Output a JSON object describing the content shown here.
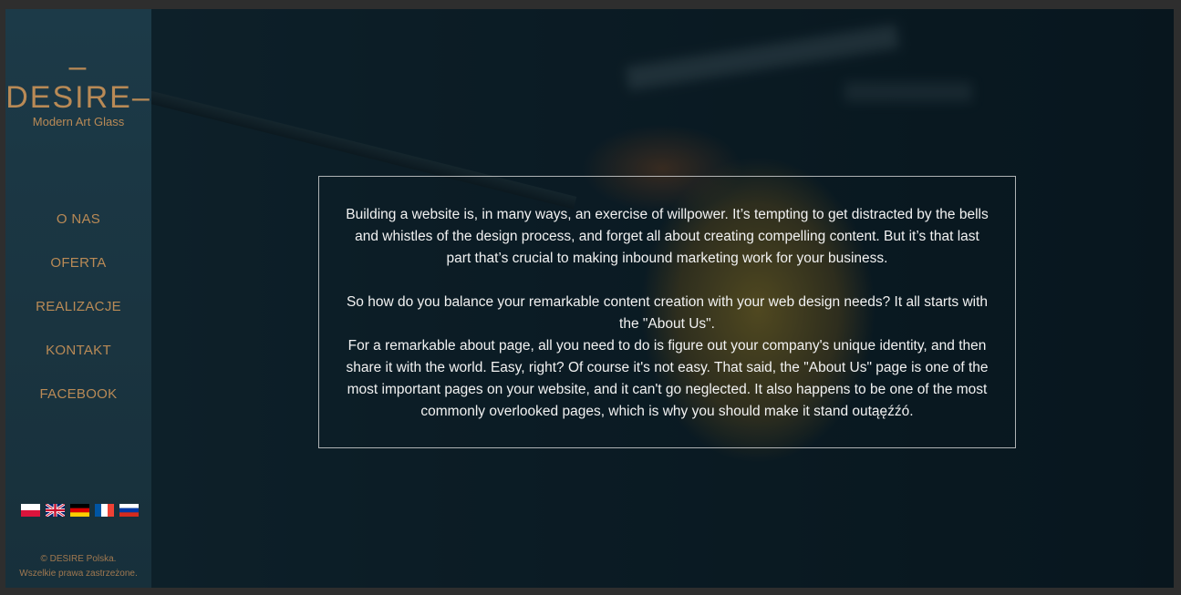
{
  "brand": {
    "title": "–DESIRE–",
    "subtitle": "Modern Art Glass"
  },
  "nav": {
    "items": [
      {
        "label": "O NAS"
      },
      {
        "label": "OFERTA"
      },
      {
        "label": "REALIZACJE"
      },
      {
        "label": "KONTAKT"
      },
      {
        "label": "FACEBOOK"
      }
    ]
  },
  "languages": [
    {
      "icon": "flag-pl-icon"
    },
    {
      "icon": "flag-uk-icon"
    },
    {
      "icon": "flag-de-icon"
    },
    {
      "icon": "flag-fr-icon"
    },
    {
      "icon": "flag-ru-icon"
    }
  ],
  "footer": {
    "line1": "© DESIRE Polska.",
    "line2": "Wszelkie prawa zastrzeżone."
  },
  "content": {
    "paragraph1": "Building a website is, in many ways, an exercise of willpower. It’s tempting to get distracted by the bells and whistles of the design process, and forget all about creating compelling content. But it’s that last part that’s crucial to making inbound marketing work for your business.",
    "paragraph2": "So how do you balance your remarkable content creation with your web design needs? It all starts with the \"About Us\".",
    "paragraph3": "For a remarkable about page, all you need to do is figure out your company's unique identity, and then share it with the world. Easy, right? Of course it's not easy. That said, the \"About Us\" page is one of the most important pages on your website, and it can't go neglected. It also happens to be one of the most commonly overlooked pages, which is why you should make it stand outąęźźó."
  },
  "colors": {
    "accent": "#b98a56",
    "sidebar": "#1c3a48",
    "text": "#f2f2f2"
  }
}
